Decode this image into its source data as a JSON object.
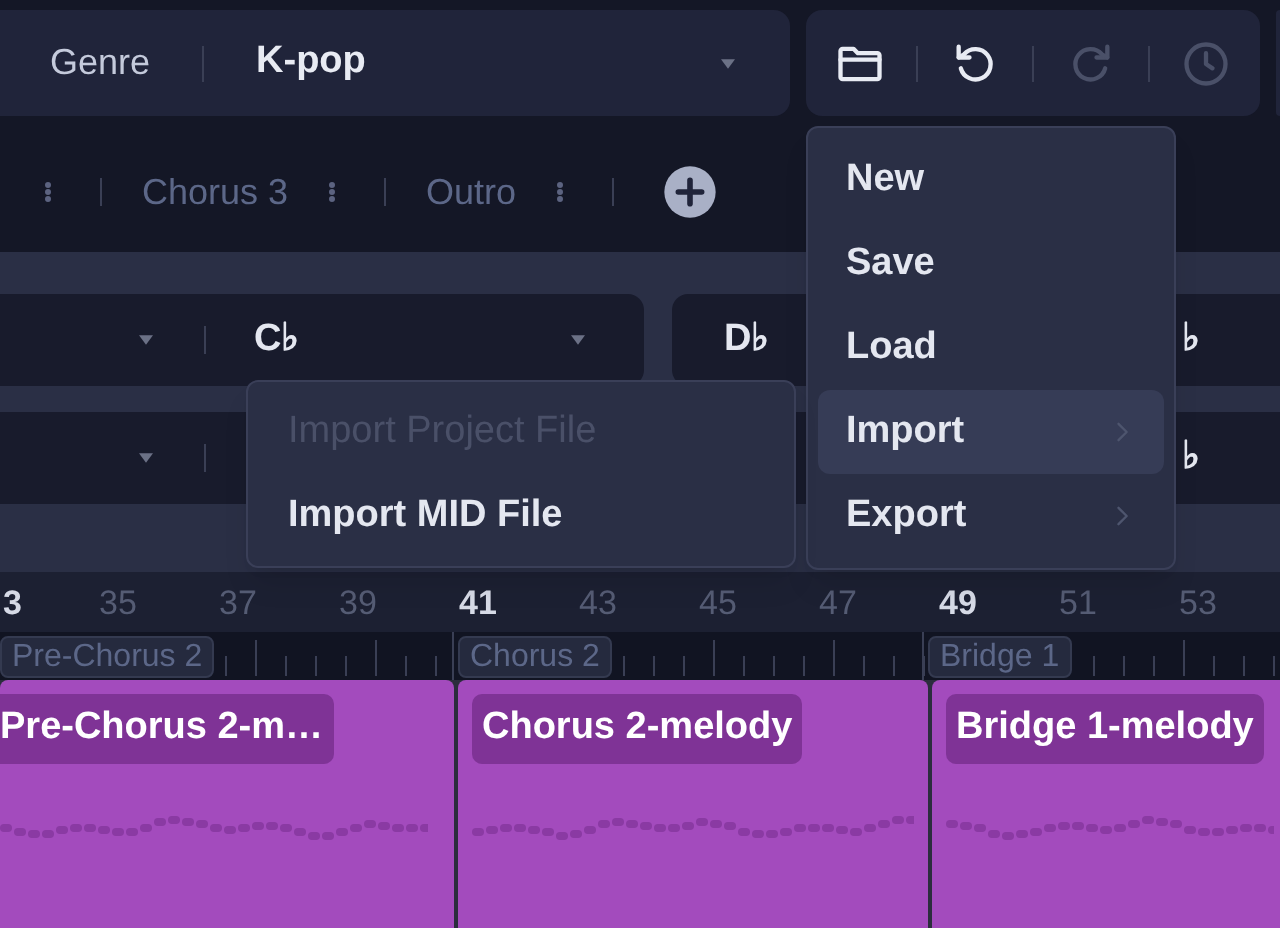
{
  "toolbar": {
    "genre_label": "Genre",
    "genre_value": "K-pop",
    "tools": [
      {
        "kind": "folder",
        "disabled": false
      },
      {
        "kind": "undo",
        "disabled": false
      },
      {
        "kind": "redo",
        "disabled": true
      },
      {
        "kind": "history",
        "disabled": true
      }
    ]
  },
  "sections": [
    {
      "label": "Chorus 3"
    },
    {
      "label": "Outro"
    }
  ],
  "key_rows": [
    {
      "select_value": "C♭",
      "next_value": "D♭",
      "edge_value": "♭"
    },
    {
      "edge_value": "♭"
    }
  ],
  "ruler": [
    {
      "label": "3",
      "major": true
    },
    {
      "label": "35",
      "major": false
    },
    {
      "label": "37",
      "major": false
    },
    {
      "label": "39",
      "major": false
    },
    {
      "label": "41",
      "major": true
    },
    {
      "label": "43",
      "major": false
    },
    {
      "label": "45",
      "major": false
    },
    {
      "label": "47",
      "major": false
    },
    {
      "label": "49",
      "major": true
    },
    {
      "label": "51",
      "major": false
    },
    {
      "label": "53",
      "major": false
    }
  ],
  "markers": [
    "Pre-Chorus 2",
    "Chorus 2",
    "Bridge 1"
  ],
  "clips": [
    {
      "title": "Pre-Chorus 2-m…"
    },
    {
      "title": "Chorus 2-melody"
    },
    {
      "title": "Bridge 1-melody"
    }
  ],
  "menu": [
    {
      "label": "New",
      "submenu": false,
      "selected": false
    },
    {
      "label": "Save",
      "submenu": false,
      "selected": false
    },
    {
      "label": "Load",
      "submenu": false,
      "selected": false
    },
    {
      "label": "Import",
      "submenu": true,
      "selected": true
    },
    {
      "label": "Export",
      "submenu": true,
      "selected": false
    }
  ],
  "submenu": [
    {
      "label": "Import Project File",
      "disabled": true
    },
    {
      "label": "Import MID File",
      "disabled": false
    }
  ]
}
